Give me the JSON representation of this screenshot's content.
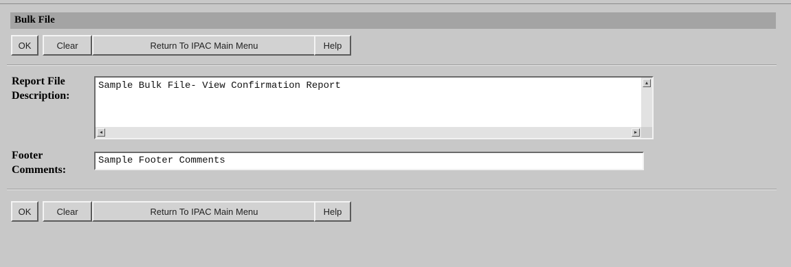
{
  "form": {
    "title": "Bulk File",
    "buttons": {
      "ok": "OK",
      "clear": "Clear",
      "return_main": "Return To IPAC Main Menu",
      "help": "Help"
    },
    "report_description": {
      "label_line1": "Report File",
      "label_line2": "Description:",
      "value": "Sample Bulk File- View Confirmation Report"
    },
    "footer_comments": {
      "label_line1": "Footer",
      "label_line2": "Comments:",
      "value": "Sample Footer Comments"
    }
  }
}
